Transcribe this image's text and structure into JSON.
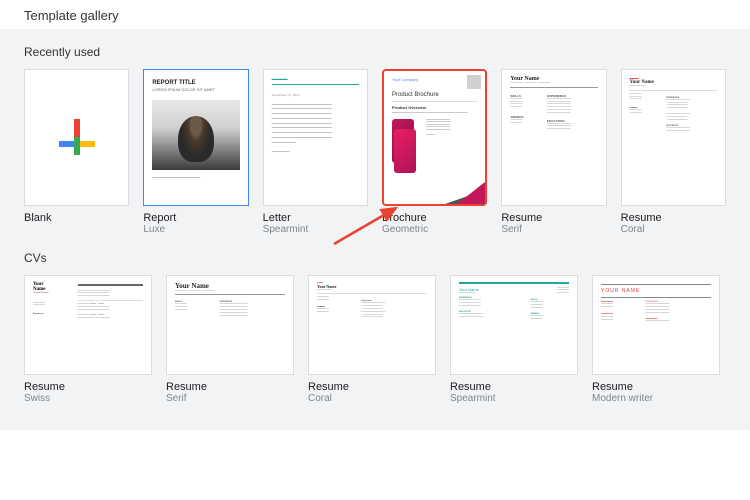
{
  "header": {
    "title": "Template gallery"
  },
  "sections": {
    "recent": {
      "title": "Recently used",
      "cards": [
        {
          "name": "Blank",
          "sub": ""
        },
        {
          "name": "Report",
          "sub": "Luxe"
        },
        {
          "name": "Letter",
          "sub": "Spearmint"
        },
        {
          "name": "Brochure",
          "sub": "Geometric"
        },
        {
          "name": "Resume",
          "sub": "Serif"
        },
        {
          "name": "Resume",
          "sub": "Coral"
        }
      ]
    },
    "cvs": {
      "title": "CVs",
      "cards": [
        {
          "name": "Resume",
          "sub": "Swiss"
        },
        {
          "name": "Resume",
          "sub": "Serif"
        },
        {
          "name": "Resume",
          "sub": "Coral"
        },
        {
          "name": "Resume",
          "sub": "Spearmint"
        },
        {
          "name": "Resume",
          "sub": "Modern writer"
        }
      ]
    }
  },
  "thumbs": {
    "report": {
      "title": "REPORT TITLE",
      "sub": "LOREM IPSUM DOLOR SIT AMET"
    },
    "brochure": {
      "company": "Your Company",
      "title": "Product Brochure",
      "sub": "Product Overview"
    },
    "resume": {
      "name": "Your Name",
      "name_caps": "YOUR NAME"
    }
  }
}
